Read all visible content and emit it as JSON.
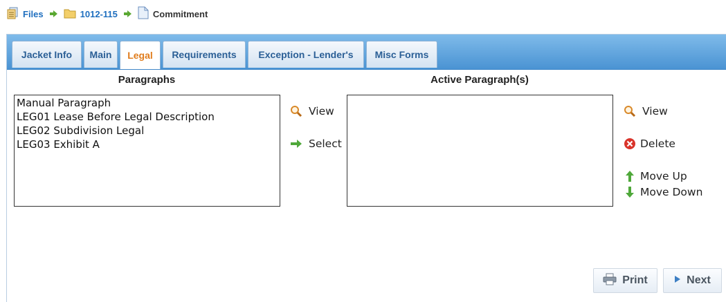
{
  "breadcrumb": {
    "items": [
      {
        "label": "Files",
        "icon": "files-icon"
      },
      {
        "label": "1012-115",
        "icon": "folder-icon"
      },
      {
        "label": "Commitment",
        "icon": "document-icon"
      }
    ]
  },
  "tabs": [
    {
      "label": "Jacket Info"
    },
    {
      "label": "Main"
    },
    {
      "label": "Legal",
      "active": true
    },
    {
      "label": "Requirements"
    },
    {
      "label": "Exception - Lender's"
    },
    {
      "label": "Misc Forms"
    }
  ],
  "paragraphs": {
    "title": "Paragraphs",
    "items": [
      "Manual Paragraph",
      "LEG01 Lease Before Legal Description",
      "LEG02 Subdivision Legal",
      "LEG03 Exhibit A"
    ]
  },
  "active_paragraphs": {
    "title": "Active Paragraph(s)",
    "items": []
  },
  "middle_actions": {
    "view": "View",
    "select": "Select"
  },
  "right_actions": {
    "view": "View",
    "delete": "Delete",
    "move_up": "Move Up",
    "move_down": "Move Down"
  },
  "buttons": {
    "print": "Print",
    "next": "Next"
  },
  "colors": {
    "link": "#1f6fbf",
    "active_tab": "#e07c1c",
    "tab_bar": "#4a93d3"
  }
}
